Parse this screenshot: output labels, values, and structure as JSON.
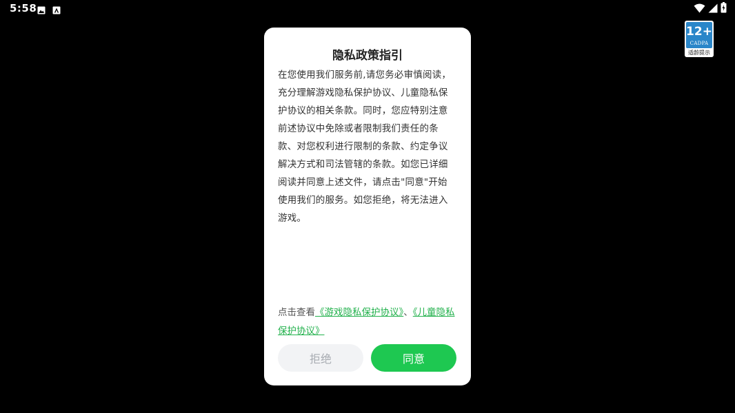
{
  "status_bar": {
    "time": "5:58",
    "left_icons": [
      "image-icon",
      "a-notification-icon"
    ],
    "right_icons": [
      "wifi-icon",
      "signal-icon",
      "battery-charging-icon"
    ],
    "color": "#ffffff"
  },
  "age_badge": {
    "rating": "12+",
    "org": "CADPA",
    "tip": "适龄提示",
    "color": "#2a86c9"
  },
  "dialog": {
    "title": "隐私政策指引",
    "body": "在您使用我们服务前,请您务必审慎阅读，充分理解游戏隐私保护协议、儿童隐私保护协议的相关条款。同时，您应特别注意前述协议中免除或者限制我们责任的条款、对您权利进行限制的条款、约定争议解决方式和司法管辖的条款。如您已详细阅读并同意上述文件，请点击\"同意\"开始使用我们的服务。如您拒绝，将无法进入游戏。",
    "links_prefix": "点击查看",
    "link_game_privacy": "《游戏隐私保护协议》",
    "link_separator": "、",
    "link_child_privacy": "《儿童隐私保护协议》",
    "reject_label": "拒绝",
    "agree_label": "同意",
    "accent_color": "#1ec851",
    "link_color": "#22b14c"
  }
}
